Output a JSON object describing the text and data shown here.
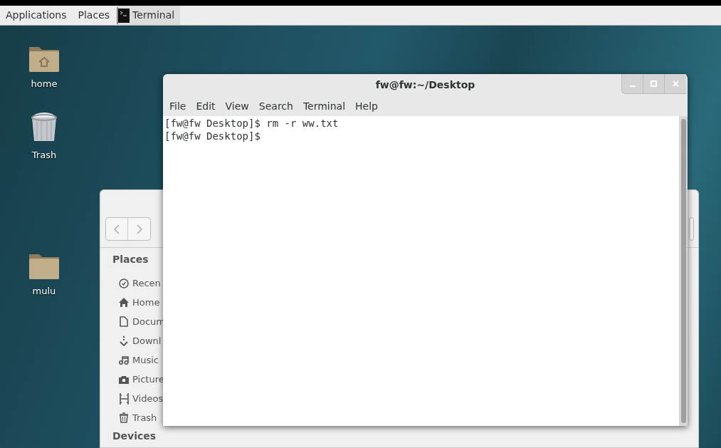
{
  "top_bar": {
    "menus": [
      "Applications",
      "Places"
    ],
    "task": {
      "label": "Terminal",
      "selected": true
    }
  },
  "desktop_icons": [
    {
      "kind": "home",
      "label": "home"
    },
    {
      "kind": "trash",
      "label": "Trash"
    },
    {
      "kind": "folder",
      "label": "mulu"
    }
  ],
  "file_manager": {
    "sidebar_heading": "Places",
    "items": [
      {
        "kind": "recent",
        "label": "Recen"
      },
      {
        "kind": "home",
        "label": "Home"
      },
      {
        "kind": "document",
        "label": "Docum"
      },
      {
        "kind": "download",
        "label": "Downl"
      },
      {
        "kind": "music",
        "label": "Music"
      },
      {
        "kind": "pictures",
        "label": "Picture"
      },
      {
        "kind": "videos",
        "label": "Videos"
      },
      {
        "kind": "trash",
        "label": "Trash"
      }
    ],
    "next_heading": "Devices"
  },
  "terminal": {
    "title": "fw@fw:~/Desktop",
    "menus": [
      "File",
      "Edit",
      "View",
      "Search",
      "Terminal",
      "Help"
    ],
    "lines": [
      "[fw@fw Desktop]$ rm -r ww.txt",
      "[fw@fw Desktop]$"
    ]
  }
}
